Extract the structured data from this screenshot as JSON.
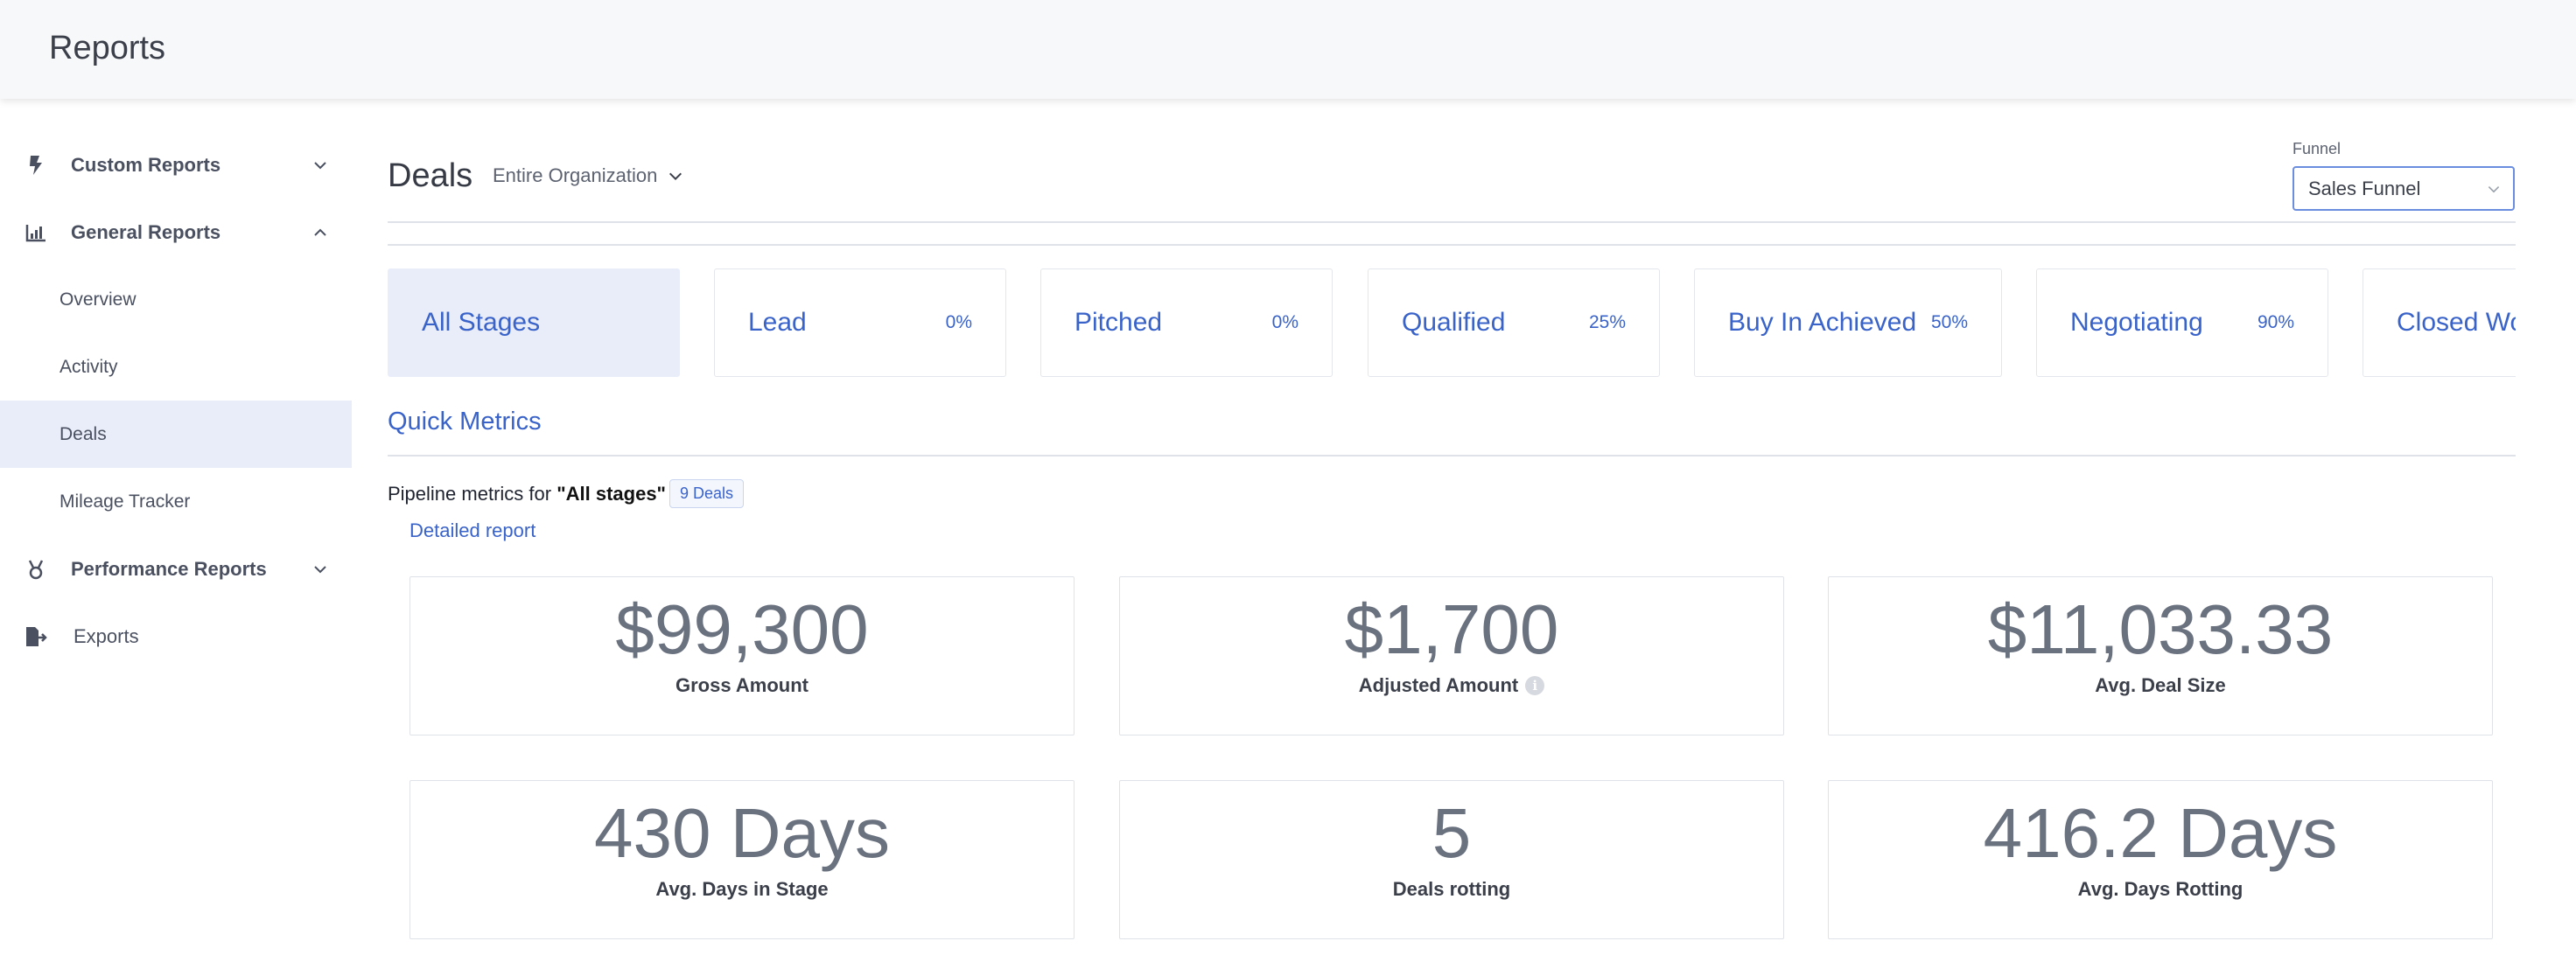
{
  "app": {
    "title": "Reports"
  },
  "sidebar": {
    "custom_reports": "Custom Reports",
    "general_reports": "General Reports",
    "items": [
      {
        "label": "Overview"
      },
      {
        "label": "Activity"
      },
      {
        "label": "Deals"
      },
      {
        "label": "Mileage Tracker"
      }
    ],
    "performance_reports": "Performance Reports",
    "exports": "Exports"
  },
  "header": {
    "title": "Deals",
    "org_select": "Entire Organization",
    "funnel_label": "Funnel",
    "funnel_value": "Sales Funnel"
  },
  "stages": [
    {
      "name": "All Stages",
      "pct": ""
    },
    {
      "name": "Lead",
      "pct": "0%"
    },
    {
      "name": "Pitched",
      "pct": "0%"
    },
    {
      "name": "Qualified",
      "pct": "25%"
    },
    {
      "name": "Buy In Achieved",
      "pct": "50%"
    },
    {
      "name": "Negotiating",
      "pct": "90%"
    },
    {
      "name": "Closed Won",
      "pct": ""
    }
  ],
  "quick_metrics": {
    "title": "Quick Metrics",
    "pipeline_prefix": "Pipeline metrics for ",
    "pipeline_stage": "\"All stages\"",
    "deals_badge": "9 Deals",
    "detailed_link": "Detailed report",
    "metrics": [
      {
        "value": "$99,300",
        "caption": "Gross Amount"
      },
      {
        "value": "$1,700",
        "caption": "Adjusted Amount"
      },
      {
        "value": "$11,033.33",
        "caption": "Avg. Deal Size"
      },
      {
        "value": "430 Days",
        "caption": "Avg. Days in Stage"
      },
      {
        "value": "5",
        "caption": "Deals rotting"
      },
      {
        "value": "416.2 Days",
        "caption": "Avg. Days Rotting"
      }
    ]
  },
  "icons": {
    "custom_reports": "lightning-icon",
    "general_reports": "bar-chart-icon",
    "performance_reports": "medal-icon",
    "exports": "file-export-icon",
    "info": "info-icon"
  },
  "colors": {
    "accent": "#3a63c9",
    "active_bg": "#e9edf9"
  }
}
